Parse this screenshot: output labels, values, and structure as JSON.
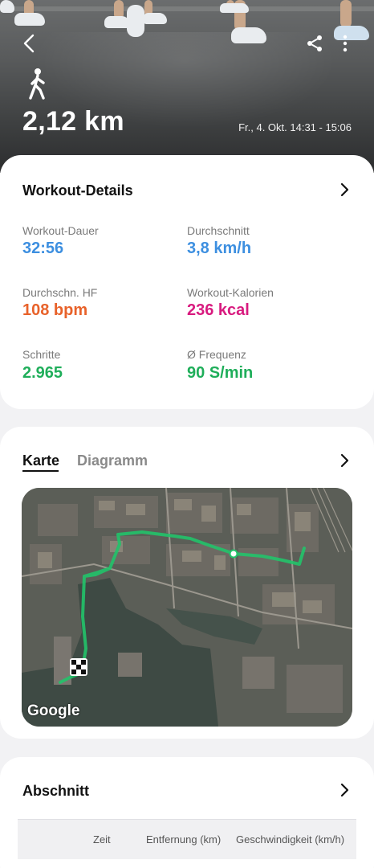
{
  "header": {
    "distance": "2,12 km",
    "date_time": "Fr., 4. Okt. 14:31 - 15:06",
    "icons": [
      "back-arrow-icon",
      "share-icon",
      "more-icon",
      "walk-icon"
    ]
  },
  "details": {
    "title": "Workout-Details",
    "metrics": [
      {
        "label": "Workout-Dauer",
        "value": "32:56",
        "color": "#3d8fe0"
      },
      {
        "label": "Durchschnitt",
        "value": "3,8 km/h",
        "color": "#3d8fe0"
      },
      {
        "label": "Durchschn. HF",
        "value": "108 bpm",
        "color": "#e8622a"
      },
      {
        "label": "Workout-Kalorien",
        "value": "236 kcal",
        "color": "#d81b7f"
      },
      {
        "label": "Schritte",
        "value": "2.965",
        "color": "#1fae5a"
      },
      {
        "label": "Ø Frequenz",
        "value": "90 S/min",
        "color": "#1fae5a"
      }
    ]
  },
  "map_card": {
    "tabs": [
      {
        "label": "Karte",
        "selected": true
      },
      {
        "label": "Diagramm",
        "selected": false
      }
    ],
    "map_logo": "Google",
    "route_color": "#22c36a"
  },
  "lap_card": {
    "title": "Abschnitt",
    "columns": [
      "Zeit",
      "Entfernung (km)",
      "Geschwindigkeit (km/h)"
    ]
  }
}
